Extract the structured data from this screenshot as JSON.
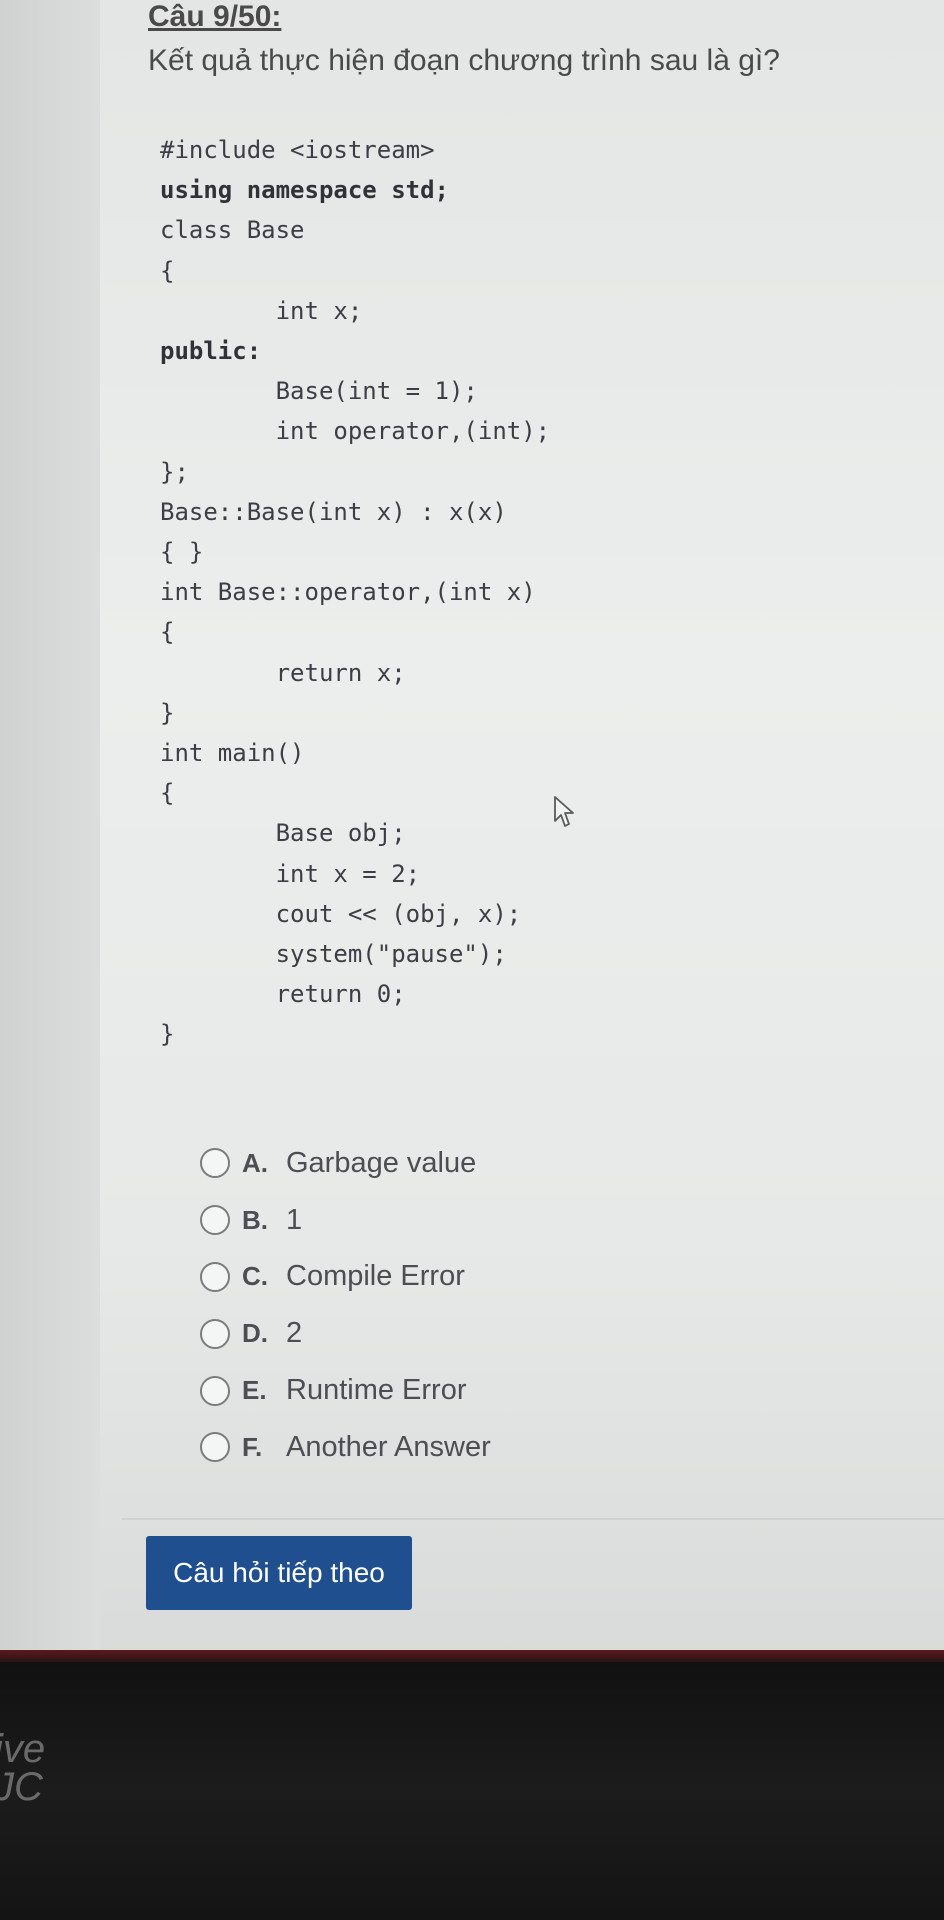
{
  "question": {
    "number": "Câu 9/50:",
    "text": "Kết quả thực hiện đoạn chương trình sau là gì?"
  },
  "code_lines": [
    "#include <iostream>",
    "using namespace std;",
    "class Base",
    "{",
    "        int x;",
    "public:",
    "        Base(int = 1);",
    "        int operator,(int);",
    "};",
    "Base::Base(int x) : x(x)",
    "{ }",
    "int Base::operator,(int x)",
    "{",
    "        return x;",
    "}",
    "int main()",
    "{",
    "        Base obj;",
    "        int x = 2;",
    "        cout << (obj, x);",
    "        system(\"pause\");",
    "        return 0;",
    "}"
  ],
  "options": [
    {
      "letter": "A.",
      "text": "Garbage value"
    },
    {
      "letter": "B.",
      "text": "1"
    },
    {
      "letter": "C.",
      "text": "Compile Error"
    },
    {
      "letter": "D.",
      "text": "2"
    },
    {
      "letter": "E.",
      "text": "Runtime Error"
    },
    {
      "letter": "F.",
      "text": "Another Answer"
    }
  ],
  "next_button": {
    "label": "Câu hỏi tiếp theo"
  },
  "sticker": {
    "text_line1": "ive",
    "text_line2": "JC"
  },
  "colors": {
    "button": "#1f4f8f",
    "text": "#4a4a4a",
    "background": "#e8eaea"
  }
}
